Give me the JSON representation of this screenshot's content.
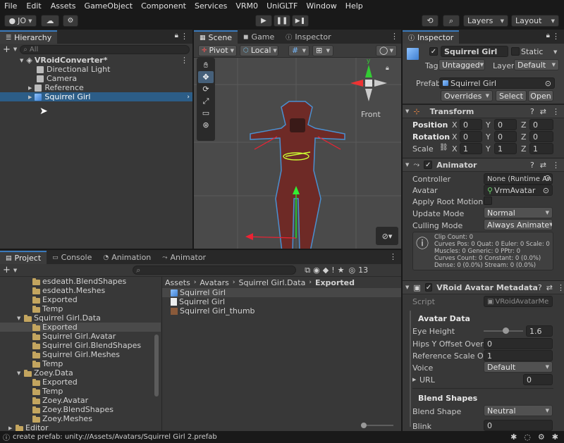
{
  "menu": [
    "File",
    "Edit",
    "Assets",
    "GameObject",
    "Component",
    "Services",
    "VRM0",
    "UniGLTF",
    "Window",
    "Help"
  ],
  "toolbar": {
    "account": "JO",
    "layers": "Layers",
    "layout": "Layout"
  },
  "hierarchy": {
    "tab": "Hierarchy",
    "search_placeholder": "All",
    "scene": "VRoidConverter*",
    "items": [
      "Directional Light",
      "Camera",
      "Reference",
      "Squirrel Girl"
    ]
  },
  "scene_tabs": [
    "Scene",
    "Game",
    "Inspector"
  ],
  "scene_toolbar": {
    "pivot": "Pivot",
    "local": "Local",
    "front": "Front"
  },
  "project": {
    "tabs": [
      "Project",
      "Console",
      "Animation",
      "Animator"
    ],
    "tree": [
      {
        "label": "esdeath.BlendShapes",
        "indent": 3
      },
      {
        "label": "esdeath.Meshes",
        "indent": 3
      },
      {
        "label": "Exported",
        "indent": 3
      },
      {
        "label": "Temp",
        "indent": 3
      },
      {
        "label": "Squirrel Girl.Data",
        "indent": 2,
        "open": true
      },
      {
        "label": "Exported",
        "indent": 3,
        "selected": true
      },
      {
        "label": "Squirrel Girl.Avatar",
        "indent": 3
      },
      {
        "label": "Squirrel Girl.BlendShapes",
        "indent": 3
      },
      {
        "label": "Squirrel Girl.Meshes",
        "indent": 3
      },
      {
        "label": "Temp",
        "indent": 3
      },
      {
        "label": "Zoey.Data",
        "indent": 2,
        "open": true
      },
      {
        "label": "Exported",
        "indent": 3
      },
      {
        "label": "Temp",
        "indent": 3
      },
      {
        "label": "Zoey.Avatar",
        "indent": 3
      },
      {
        "label": "Zoey.BlendShapes",
        "indent": 3
      },
      {
        "label": "Zoey.Meshes",
        "indent": 3
      },
      {
        "label": "Editor",
        "indent": 1
      }
    ],
    "breadcrumb": [
      "Assets",
      "Avatars",
      "Squirrel Girl.Data",
      "Exported"
    ],
    "files": [
      "Squirrel Girl",
      "Squirrel Girl",
      "Squirrel Girl_thumb"
    ],
    "count": "13"
  },
  "status": "create prefab: unity://Assets/Avatars/Squirrel Girl 2.prefab",
  "inspector": {
    "tab": "Inspector",
    "name": "Squirrel Girl",
    "static": "Static",
    "tag_label": "Tag",
    "tag": "Untagged",
    "layer_label": "Layer",
    "layer": "Default",
    "prefab_label": "Prefab",
    "prefab": "Squirrel Girl",
    "overrides": "Overrides",
    "select": "Select",
    "open": "Open",
    "transform": {
      "title": "Transform",
      "position": "Position",
      "rotation": "Rotation",
      "scale": "Scale",
      "pos": [
        "0",
        "0",
        "0"
      ],
      "rot": [
        "0",
        "0",
        "0"
      ],
      "scl": [
        "1",
        "1",
        "1"
      ]
    },
    "animator": {
      "title": "Animator",
      "controller_label": "Controller",
      "controller": "None (Runtime An",
      "avatar_label": "Avatar",
      "avatar": "VrmAvatar",
      "root_motion": "Apply Root Motion",
      "update_label": "Update Mode",
      "update": "Normal",
      "culling_label": "Culling Mode",
      "culling": "Always Animate",
      "info": [
        "Clip Count: 0",
        "Curves Pos: 0 Quat: 0 Euler: 0 Scale: 0",
        "Muscles: 0 Generic: 0 PPtr: 0",
        "Curves Count: 0 Constant: 0 (0.0%)",
        "Dense: 0 (0.0%) Stream: 0 (0.0%)"
      ]
    },
    "vroid": {
      "title": "VRoid Avatar Metadata",
      "script_label": "Script",
      "script": "VRoidAvatarMe",
      "avatar_data": "Avatar Data",
      "eye_height_label": "Eye Height",
      "eye_height": "1.6",
      "eye_height_slider": 0.55,
      "hips_label": "Hips Y Offset Over...",
      "hips": "0",
      "ref_scale_label": "Reference Scale O...",
      "ref_scale": "1",
      "voice_label": "Voice",
      "voice": "Default",
      "url_label": "URL",
      "url": "0",
      "blend_shapes": "Blend Shapes",
      "blend_shape_label": "Blend Shape",
      "blend_shape": "Neutral",
      "blink_label": "Blink",
      "blink": "0"
    }
  },
  "colors": {
    "selection": "#2c5d87",
    "accent": "#3a79bb"
  }
}
